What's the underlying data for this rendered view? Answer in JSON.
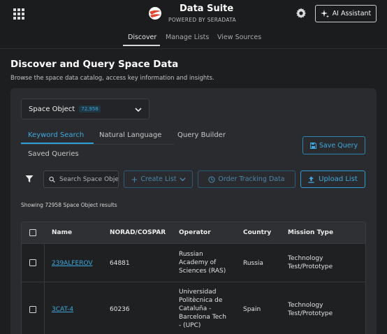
{
  "header": {
    "app_title": "Data Suite",
    "powered_by": "POWERED BY SERADATA",
    "ai_assistant_label": "AI Assistant",
    "icons": [
      "apps-grid-icon",
      "logo-icon",
      "gear-icon",
      "sparkle-icon"
    ]
  },
  "nav": {
    "items": [
      {
        "label": "Discover",
        "active": true
      },
      {
        "label": "Manage Lists",
        "active": false
      },
      {
        "label": "View Sources",
        "active": false
      }
    ]
  },
  "page": {
    "title": "Discover and Query Space Data",
    "subtitle": "Browse the space data catalog, access key information and insights."
  },
  "object_select": {
    "label": "Space Object",
    "count": "72,958"
  },
  "tabs": [
    {
      "label": "Keyword Search",
      "active": true
    },
    {
      "label": "Natural Language",
      "active": false
    },
    {
      "label": "Query Builder",
      "active": false
    },
    {
      "label": "Saved Queries",
      "active": false
    }
  ],
  "toolbar": {
    "save_query_label": "Save Query",
    "search_placeholder": "Search Space Objects",
    "create_list_label": "Create List",
    "order_tracking_label": "Order Tracking Data",
    "upload_list_label": "Upload List"
  },
  "results_text": "Showing 72958 Space Object results",
  "table": {
    "columns": [
      "Name",
      "NORAD/COSPAR",
      "Operator",
      "Country",
      "Mission Type"
    ],
    "rows": [
      {
        "name": "239ALFEROV",
        "norad": "64881",
        "operator": [
          "Russian",
          "Academy of",
          "Sciences (RAS)"
        ],
        "country": "Russia",
        "mission": [
          "Technology",
          "Test/Prototype"
        ]
      },
      {
        "name": "3CAT-4",
        "norad": "60236",
        "operator": [
          "Universidad",
          "Politècnica de",
          "Cataluña -",
          "Barcelona Tech",
          "- (UPC)"
        ],
        "country": "Spain",
        "mission": [
          "Technology",
          "Test/Prototype"
        ]
      }
    ]
  },
  "colors": {
    "accent": "#3ea9e0",
    "background": "#1d1e20",
    "panel": "#2a2b2e"
  }
}
